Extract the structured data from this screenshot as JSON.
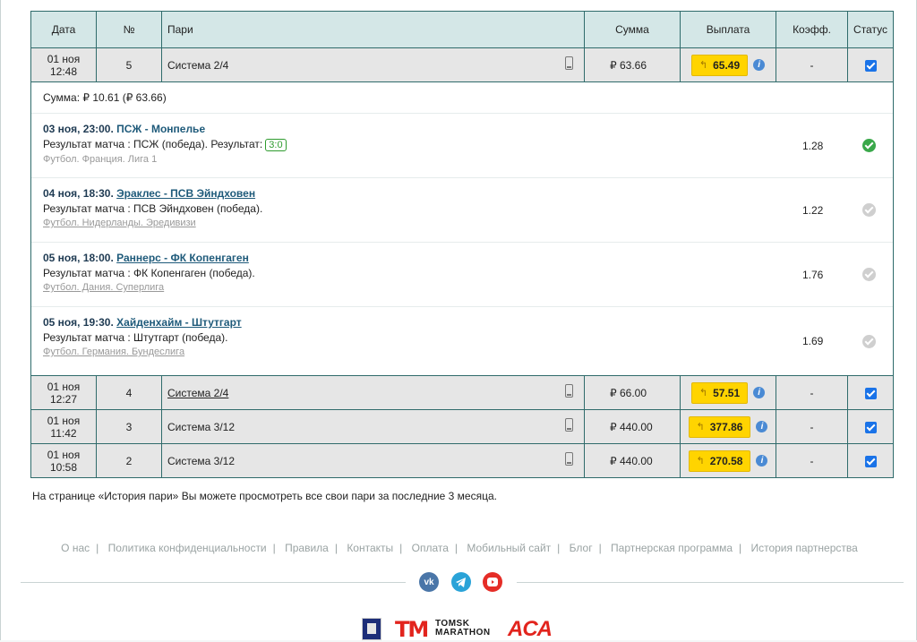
{
  "table": {
    "headers": {
      "date": "Дата",
      "num": "№",
      "bets": "Пари",
      "sum": "Сумма",
      "payout": "Выплата",
      "coef": "Коэфф.",
      "status": "Статус"
    },
    "rows": [
      {
        "date": "01 ноя",
        "time": "12:48",
        "num": "5",
        "name": "Система 2/4",
        "sum": "₽ 63.66",
        "payout": "65.49",
        "coef": "-"
      },
      {
        "date": "01 ноя",
        "time": "12:27",
        "num": "4",
        "name": "Система 2/4",
        "sum": "₽ 66.00",
        "payout": "57.51",
        "coef": "-"
      },
      {
        "date": "01 ноя",
        "time": "11:42",
        "num": "3",
        "name": "Система 3/12",
        "sum": "₽ 440.00",
        "payout": "377.86",
        "coef": "-"
      },
      {
        "date": "01 ноя",
        "time": "10:58",
        "num": "2",
        "name": "Система 3/12",
        "sum": "₽ 440.00",
        "payout": "270.58",
        "coef": "-"
      }
    ],
    "payout_arrow": "↰",
    "info_label": "i"
  },
  "detail": {
    "sum_line": "Сумма: ₽ 10.61 (₽ 63.66)",
    "events": [
      {
        "when": "03 ноя, 23:00.",
        "teams": "ПСЖ - Монпелье",
        "result": "Результат матча : ПСЖ (победа). Результат:",
        "score": "3:0",
        "league": "Футбол. Франция. Лига 1",
        "coef": "1.28",
        "status": "win"
      },
      {
        "when": "04 ноя, 18:30.",
        "teams": "Эраклес - ПСВ Эйндховен",
        "result": "Результат матча : ПСВ Эйндховен (победа).",
        "league": "Футбол. Нидерланды. Эредивизи",
        "coef": "1.22",
        "status": "pending"
      },
      {
        "when": "05 ноя, 18:00.",
        "teams": "Раннерс - ФК Копенгаген",
        "result": "Результат матча : ФК Копенгаген (победа).",
        "league": "Футбол. Дания. Суперлига",
        "coef": "1.76",
        "status": "pending"
      },
      {
        "when": "05 ноя, 19:30.",
        "teams": "Хайденхайм - Штутгарт",
        "result": "Результат матча : Штутгарт (победа).",
        "league": "Футбол. Германия. Бундеслига",
        "coef": "1.69",
        "status": "pending"
      }
    ]
  },
  "note": "На странице «История пари» Вы можете просмотреть все свои пари за последние 3 месяца.",
  "footer": {
    "links": [
      "О нас",
      "Политика конфиденциальности",
      "Правила",
      "Контакты",
      "Оплата",
      "Мобильный сайт",
      "Блог",
      "Партнерская программа",
      "История партнерства"
    ],
    "separator": "|",
    "social": {
      "vk": "vk",
      "telegram": "telegram-icon",
      "youtube": "youtube-icon"
    },
    "logos": {
      "tm": "TM",
      "marathon_top": "TOMSK",
      "marathon_bottom": "MARATHON",
      "aca": "ACA"
    }
  },
  "colors": {
    "header_bg": "#d4e7e7",
    "border": "#2f6b6b",
    "row_bg": "#e6e6e6",
    "payout_bg": "#ffd400",
    "win": "#3aa84a",
    "link": "#1e5a7a"
  }
}
